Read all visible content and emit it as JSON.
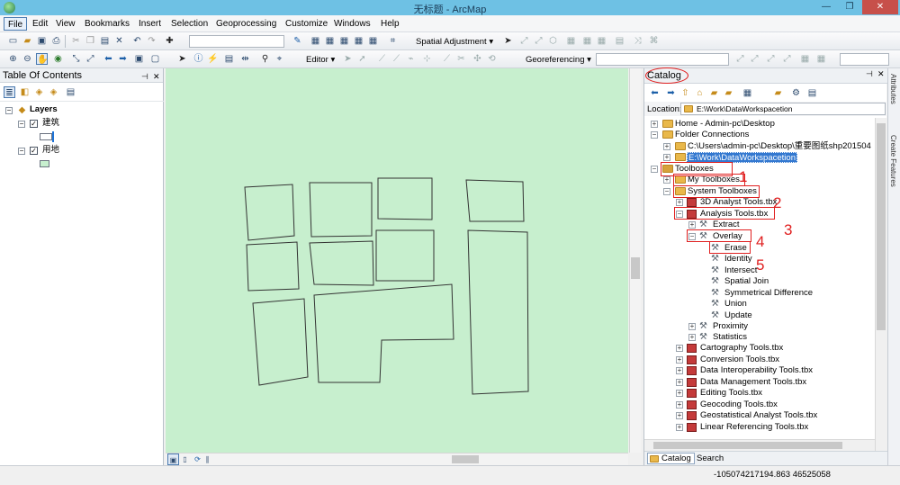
{
  "window": {
    "title": "无标题 - ArcMap",
    "minimize": "—",
    "maximize": "❐",
    "close": "✕"
  },
  "menu": [
    "File",
    "Edit",
    "View",
    "Bookmarks",
    "Insert",
    "Selection",
    "Geoprocessing",
    "Customize",
    "Windows",
    "Help"
  ],
  "toolbars": {
    "spatial_adjustment": "Spatial Adjustment ▾",
    "editor": "Editor ▾",
    "georeferencing": "Georeferencing ▾"
  },
  "toc": {
    "title": "Table Of Contents",
    "root": "Layers",
    "layers": [
      {
        "name": "建筑",
        "checked": true
      },
      {
        "name": "用地",
        "checked": true
      }
    ]
  },
  "catalog": {
    "title": "Catalog",
    "location_label": "Location:",
    "location_value": "E:\\Work\\DataWorkspacetion",
    "tree": {
      "home": "Home - Admin-pc\\Desktop",
      "folder_connections": "Folder Connections",
      "conn1": "C:\\Users\\admin-pc\\Desktop\\重要图纸shp201504",
      "conn2": "E:\\Work\\DataWorkspacetion",
      "toolboxes": "Toolboxes",
      "my_toolboxes": "My Toolboxes",
      "system_toolboxes": "System Toolboxes",
      "analyst3d": "3D Analyst Tools.tbx",
      "analysis": "Analysis Tools.tbx",
      "extract": "Extract",
      "overlay": "Overlay",
      "overlay_tools": [
        "Erase",
        "Identity",
        "Intersect",
        "Spatial Join",
        "Symmetrical Difference",
        "Union",
        "Update"
      ],
      "proximity": "Proximity",
      "statistics": "Statistics",
      "toolboxes_more": [
        "Cartography Tools.tbx",
        "Conversion Tools.tbx",
        "Data Interoperability Tools.tbx",
        "Data Management Tools.tbx",
        "Editing Tools.tbx",
        "Geocoding Tools.tbx",
        "Geostatistical Analyst Tools.tbx",
        "Linear Referencing Tools.tbx"
      ]
    },
    "tabs": [
      "Catalog",
      "Search"
    ]
  },
  "side_strip": [
    "Attributes",
    "Create Features"
  ],
  "annotations": [
    "1",
    "2",
    "3",
    "4",
    "5"
  ],
  "status": {
    "coords": "-105074217194.863  46525058"
  },
  "colors": {
    "map_bg": "#c7efce",
    "annotation_red": "#e02020",
    "selection": "#3378d0"
  }
}
